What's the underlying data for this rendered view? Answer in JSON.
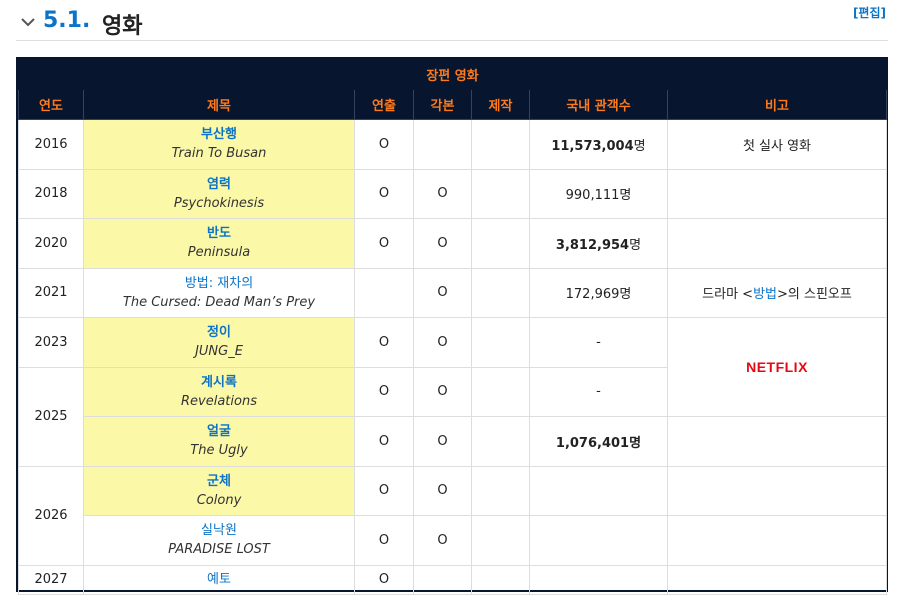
{
  "section": {
    "number": "5.1.",
    "title": "영화",
    "edit_label": "[편집]"
  },
  "table": {
    "caption": "장편 영화",
    "headers": {
      "year": "연도",
      "title": "제목",
      "direct": "연출",
      "script": "각본",
      "produce": "제작",
      "audience": "국내 관객수",
      "note": "비고"
    },
    "rows": [
      {
        "year": "2016",
        "title_ko": "부산행",
        "title_en": "Train To Busan",
        "direct": "O",
        "script": "",
        "produce": "",
        "audience": "11,573,004",
        "unit": "명",
        "note": "첫 실사 영화"
      },
      {
        "year": "2018",
        "title_ko": "염력",
        "title_en": "Psychokinesis",
        "direct": "O",
        "script": "O",
        "produce": "",
        "audience": "990,111",
        "unit": "명",
        "note": ""
      },
      {
        "year": "2020",
        "title_ko": "반도",
        "title_en": "Peninsula",
        "direct": "O",
        "script": "O",
        "produce": "",
        "audience": "3,812,954",
        "unit": "명",
        "note": ""
      },
      {
        "year": "2021",
        "title_ko": "방법: 재차의",
        "title_en": "The Cursed: Dead Man’s Prey",
        "direct": "",
        "script": "O",
        "produce": "",
        "audience": "172,969",
        "unit": "명",
        "note_prefix": "드라마 <",
        "note_link": "방법",
        "note_suffix": ">의 스핀오프"
      },
      {
        "year": "2023",
        "title_ko": "정이",
        "title_en": "JUNG_E",
        "direct": "O",
        "script": "O",
        "produce": "",
        "audience": "-",
        "note": "NETFLIX"
      },
      {
        "year": "2025",
        "title_ko": "계시록",
        "title_en": "Revelations",
        "direct": "O",
        "script": "O",
        "produce": "",
        "audience": "-"
      },
      {
        "title_ko": "얼굴",
        "title_en": "The Ugly",
        "direct": "O",
        "script": "O",
        "produce": "",
        "audience": "1,076,401",
        "unit": "명",
        "note": ""
      },
      {
        "year": "2026",
        "title_ko": "군체",
        "title_en": "Colony",
        "direct": "O",
        "script": "O",
        "produce": "",
        "audience": "",
        "note": ""
      },
      {
        "title_ko": "실낙원",
        "title_en": "PARADISE LOST",
        "direct": "O",
        "script": "O",
        "produce": "",
        "audience": "",
        "note": ""
      },
      {
        "year": "2027",
        "title_ko": "예토",
        "direct": "O",
        "script": "",
        "produce": "",
        "audience": "",
        "note": ""
      }
    ]
  }
}
